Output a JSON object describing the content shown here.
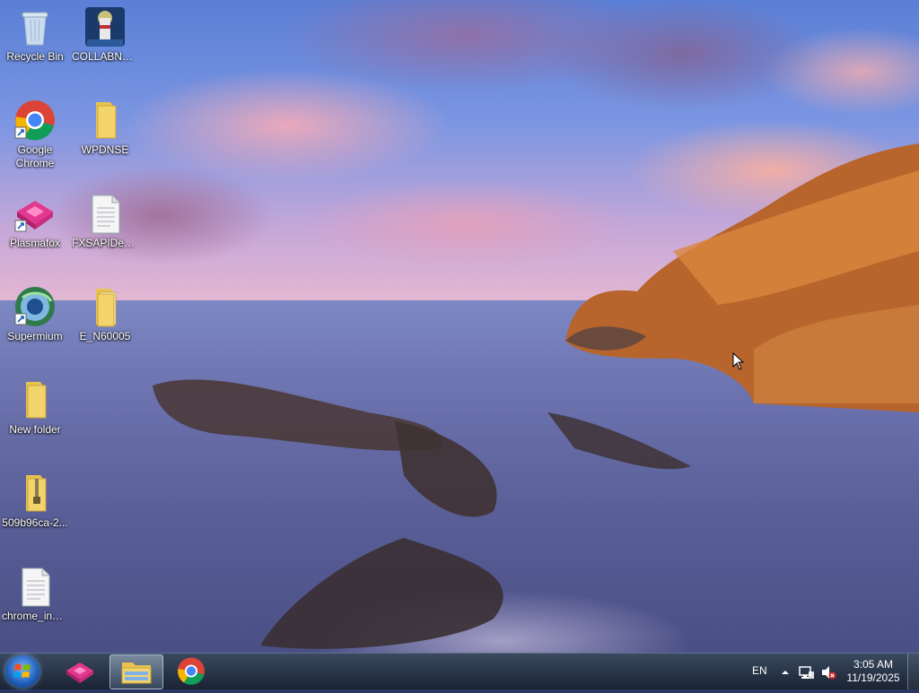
{
  "desktop": {
    "icons": [
      {
        "label": "Recycle Bin",
        "icon": "recycle-bin-icon"
      },
      {
        "label": "COLLABNE...",
        "icon": "lighthouse-app-icon"
      },
      {
        "label": "Google Chrome",
        "icon": "chrome-icon"
      },
      {
        "label": "WPDNSE",
        "icon": "folder-icon"
      },
      {
        "label": "Plasmafox",
        "icon": "plasmafox-icon"
      },
      {
        "label": "FXSAPIDeb...",
        "icon": "text-file-icon"
      },
      {
        "label": "Supermium",
        "icon": "supermium-icon"
      },
      {
        "label": "E_N60005",
        "icon": "folder-icon"
      },
      {
        "label": "New folder",
        "icon": "folder-icon"
      },
      {
        "label": "509b96ca-2...",
        "icon": "zip-folder-icon"
      },
      {
        "label": "chrome_inst...",
        "icon": "text-file-icon"
      }
    ]
  },
  "taskbar": {
    "pinned": [
      {
        "name": "Plasmafox",
        "icon": "plasmafox-icon"
      },
      {
        "name": "Windows Explorer",
        "icon": "explorer-folder-icon"
      },
      {
        "name": "Google Chrome",
        "icon": "chrome-icon"
      }
    ],
    "tray": {
      "language": "EN",
      "time": "3:05 AM",
      "date": "11/19/2025"
    }
  },
  "colors": {
    "taskbar": "#1f2b3c",
    "folder": "#f3d36b",
    "accent": "#1e5fb8"
  }
}
